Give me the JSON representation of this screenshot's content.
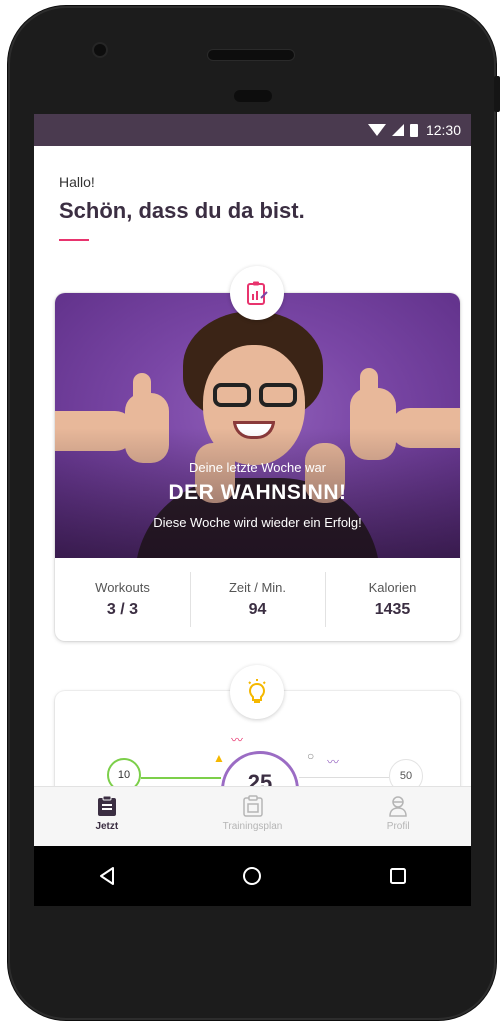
{
  "status_bar": {
    "time": "12:30"
  },
  "header": {
    "greeting": "Hallo!",
    "title": "Schön, dass du da bist."
  },
  "weekly_card": {
    "icon": "clipboard-chart-icon",
    "hero_subtitle": "Deine letzte Woche war",
    "hero_title": "DER WAHNSINN!",
    "hero_footer": "Diese Woche wird wieder ein Erfolg!",
    "stats": [
      {
        "label": "Workouts",
        "value": "3 / 3"
      },
      {
        "label": "Zeit / Min.",
        "value": "94"
      },
      {
        "label": "Kalorien",
        "value": "1435"
      }
    ]
  },
  "goal_card": {
    "icon": "lightbulb-icon",
    "milestones": [
      "10",
      "25",
      "50"
    ]
  },
  "bottom_nav": {
    "items": [
      {
        "label": "Jetzt",
        "icon": "clipboard-icon",
        "active": true
      },
      {
        "label": "Trainingsplan",
        "icon": "calendar-icon",
        "active": false
      },
      {
        "label": "Profil",
        "icon": "user-icon",
        "active": false
      }
    ]
  },
  "colors": {
    "accent": "#e8346e",
    "brand_dark": "#3b2e42",
    "status_bar": "#4a3a4f",
    "hero_purple": "#7a47a6",
    "goal_green": "#7ccf4a",
    "goal_purple": "#9b6cc4"
  }
}
